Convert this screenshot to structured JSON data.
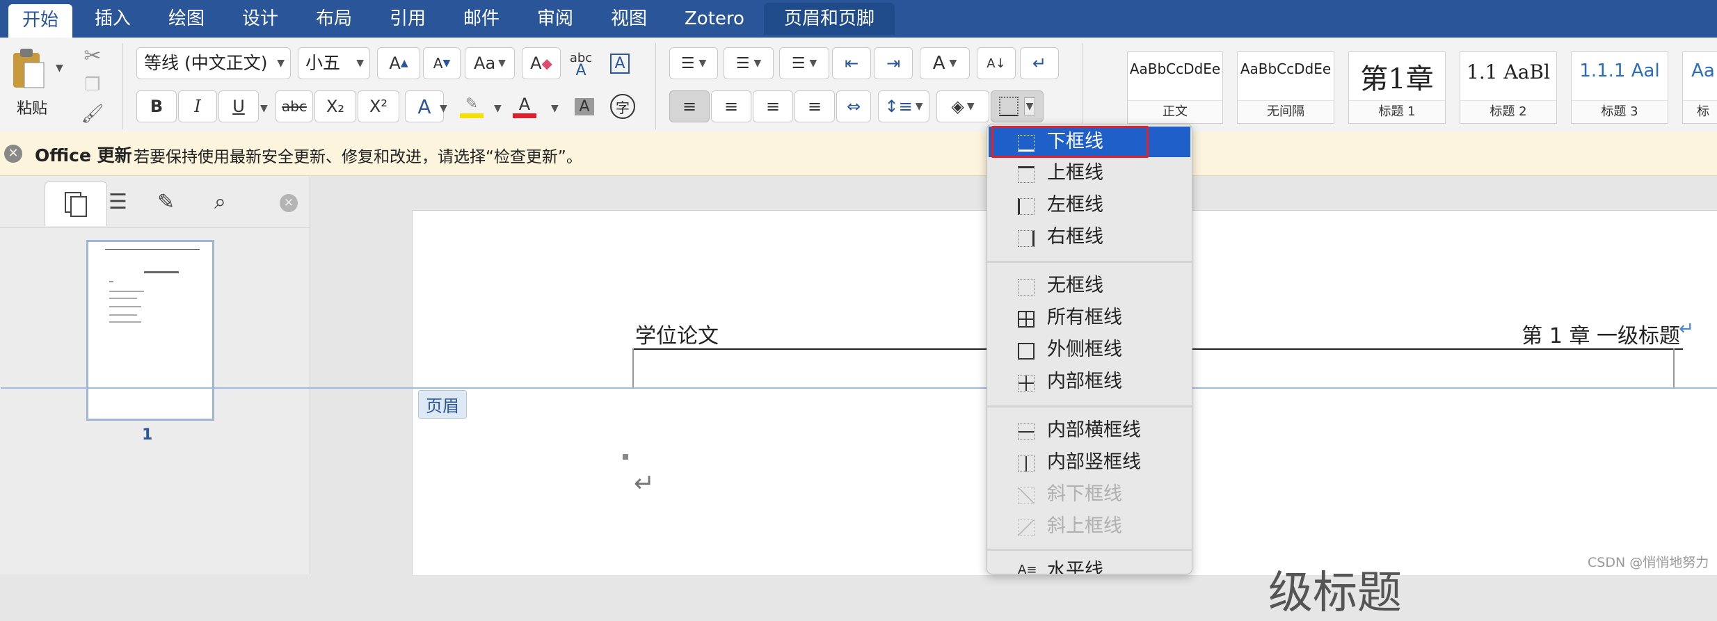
{
  "tabs": [
    {
      "label": "开始",
      "active": true
    },
    {
      "label": "插入"
    },
    {
      "label": "绘图"
    },
    {
      "label": "设计"
    },
    {
      "label": "布局"
    },
    {
      "label": "引用"
    },
    {
      "label": "邮件"
    },
    {
      "label": "审阅"
    },
    {
      "label": "视图"
    },
    {
      "label": "Zotero"
    },
    {
      "label": "页眉和页脚"
    }
  ],
  "ribbon": {
    "paste_label": "粘贴",
    "font_name": "等线 (中文正文)",
    "font_size": "小五",
    "bold": "B",
    "italic": "I",
    "underline": "U",
    "strike": "abc",
    "subscript": "X₂",
    "superscript": "X²",
    "spell_label": "abc",
    "char_label": "字"
  },
  "styles": [
    {
      "sample": "AaBbCcDdEe",
      "name": "正文"
    },
    {
      "sample": "AaBbCcDdEe",
      "name": "无间隔"
    },
    {
      "sample": "第1章",
      "name": "标题 1"
    },
    {
      "sample": "1.1   AaBl",
      "name": "标题 2"
    },
    {
      "sample": "1.1.1   Aal",
      "name": "标题 3"
    },
    {
      "sample": "Aa",
      "name": "标"
    }
  ],
  "notification": {
    "title": "Office 更新",
    "message": "若要保持使用最新安全更新、修复和改进，请选择“检查更新”。"
  },
  "nav": {
    "page_number": "1"
  },
  "document": {
    "header_left": "学位论文",
    "header_right": "第 1 章  一级标题",
    "header_tag": "页眉",
    "return_mark": "↵",
    "big_title_partial": "级标题"
  },
  "border_menu": {
    "items": [
      {
        "label": "下框线",
        "highlighted": true
      },
      {
        "label": "上框线"
      },
      {
        "label": "左框线"
      },
      {
        "label": "右框线"
      },
      {
        "label": "无框线"
      },
      {
        "label": "所有框线"
      },
      {
        "label": "外侧框线"
      },
      {
        "label": "内部框线"
      },
      {
        "label": "内部横框线"
      },
      {
        "label": "内部竖框线"
      },
      {
        "label": "斜下框线",
        "disabled": true
      },
      {
        "label": "斜上框线",
        "disabled": true
      },
      {
        "label": "水平线"
      }
    ]
  },
  "watermark": "CSDN @悄悄地努力",
  "colors": {
    "tabbar": "#2a5699",
    "menu_highlight": "#1e5fc9",
    "callout": "#e0202a",
    "font_color": "#e0202a",
    "highlight_color": "#f5e100"
  }
}
